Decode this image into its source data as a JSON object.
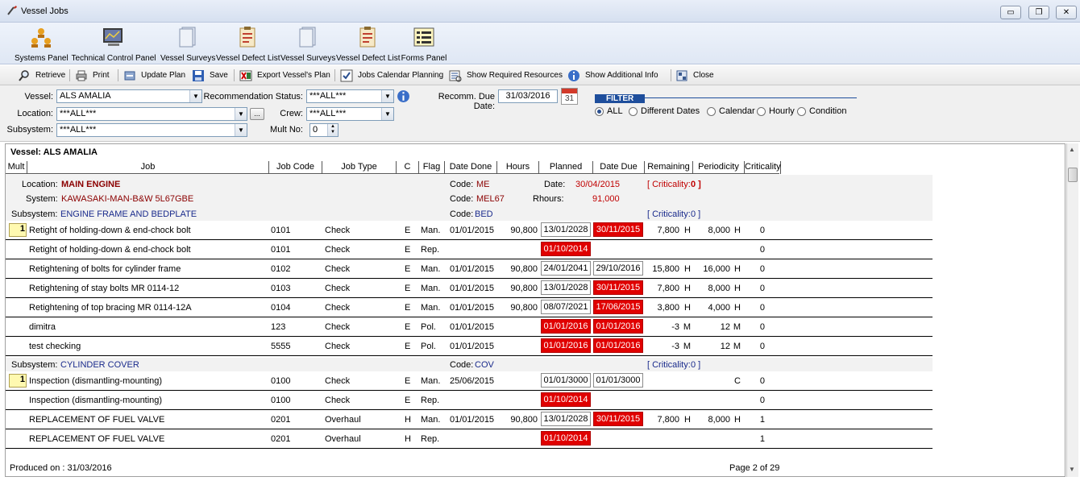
{
  "window": {
    "title": "Vessel Jobs",
    "minimize": "▭",
    "restore": "❐",
    "close": "✕"
  },
  "panels": [
    {
      "label": "Systems Panel",
      "icon": "systems-panel-icon"
    },
    {
      "label": "Technical Control Panel",
      "icon": "technical-control-panel-icon"
    },
    {
      "label": "Vessel Surveys",
      "icon": "vessel-surveys-icon"
    },
    {
      "label": "Vessel Defect List",
      "icon": "vessel-defect-list-icon"
    },
    {
      "label": "Vessel Surveys",
      "icon": "vessel-surveys-icon"
    },
    {
      "label": "Vessel Defect List",
      "icon": "vessel-defect-list-icon"
    },
    {
      "label": "Forms Panel",
      "icon": "forms-panel-icon"
    }
  ],
  "toolbar": {
    "retrieve": "Retrieve",
    "print": "Print",
    "update_plan": "Update Plan",
    "save": "Save",
    "export": "Export Vessel's Plan",
    "calendar": "Jobs Calendar Planning",
    "resources": "Show Required Resources",
    "info": "Show Additional Info",
    "close": "Close"
  },
  "filters": {
    "vessel_label": "Vessel:",
    "vessel_value": "ALS AMALIA",
    "location_label": "Location:",
    "location_value": "***ALL***",
    "subsystem_label": "Subsystem:",
    "subsystem_value": "***ALL***",
    "rec_status_label": "Recommendation Status:",
    "rec_status_value": "***ALL***",
    "crew_label": "Crew:",
    "crew_value": "***ALL***",
    "mult_label": "Mult No:",
    "mult_value": "0",
    "due_date_label": "Recomm. Due Date:",
    "due_date_value": "31/03/2016",
    "calendar_day": "31",
    "ellipsis": "...",
    "filter_title": "FILTER",
    "radios": [
      "ALL",
      "Different Dates",
      "Calendar",
      "Hourly",
      "Condition"
    ],
    "radio_selected": "ALL"
  },
  "report": {
    "vessel_header": "Vessel:  ALS AMALIA",
    "columns": [
      "Mult",
      "Job",
      "Job Code",
      "Job Type",
      "C",
      "Flag",
      "Date Done",
      "Hours",
      "Planned",
      "Date Due",
      "Remaining",
      "Periodicity",
      "Criticality"
    ],
    "location": {
      "location_label": "Location:",
      "location_value": "MAIN ENGINE",
      "system_label": "System:",
      "system_value": "KAWASAKI-MAN-B&W 5L67GBE",
      "code_label": "Code:",
      "code_value": "ME",
      "date_label": "Date:",
      "date_value": "30/04/2015",
      "criticality_label": "[ Criticality:",
      "criticality_value": "0 ]",
      "code2_label": "Code:",
      "code2_value": "MEL67",
      "rhours_label": "Rhours:",
      "rhours_value": "91,000"
    },
    "subsystems": [
      {
        "label": "Subsystem:",
        "name": "ENGINE FRAME AND BEDPLATE",
        "code_label": "Code:",
        "code": "BED",
        "criticality_label": "[ Criticality:",
        "criticality": "0 ]",
        "rows": [
          {
            "mult": "1",
            "job": "Retight of holding-down & end-chock bolt",
            "code": "0101",
            "type": "Check",
            "c": "E",
            "flag": "Man.",
            "done": "01/01/2015",
            "hours": "90,800",
            "planned": "13/01/2028",
            "planned_red": false,
            "due": "30/11/2015",
            "due_red": true,
            "remaining": "7,800",
            "rem_unit": "H",
            "period": "8,000",
            "per_unit": "H",
            "crit": "0"
          },
          {
            "mult": "",
            "job": "Retight of holding-down & end-chock bolt",
            "code": "0101",
            "type": "Check",
            "c": "E",
            "flag": "Rep.",
            "done": "",
            "hours": "",
            "planned": "01/10/2014",
            "planned_red": true,
            "due": "",
            "due_red": false,
            "remaining": "",
            "rem_unit": "",
            "period": "",
            "per_unit": "",
            "crit": "0"
          },
          {
            "mult": "",
            "job": "Retightening of bolts for cylinder frame",
            "code": "0102",
            "type": "Check",
            "c": "E",
            "flag": "Man.",
            "done": "01/01/2015",
            "hours": "90,800",
            "planned": "24/01/2041",
            "planned_red": false,
            "due": "29/10/2016",
            "due_red": false,
            "remaining": "15,800",
            "rem_unit": "H",
            "period": "16,000",
            "per_unit": "H",
            "crit": "0"
          },
          {
            "mult": "",
            "job": "Retightening of stay bolts MR 0114-12",
            "code": "0103",
            "type": "Check",
            "c": "E",
            "flag": "Man.",
            "done": "01/01/2015",
            "hours": "90,800",
            "planned": "13/01/2028",
            "planned_red": false,
            "due": "30/11/2015",
            "due_red": true,
            "remaining": "7,800",
            "rem_unit": "H",
            "period": "8,000",
            "per_unit": "H",
            "crit": "0"
          },
          {
            "mult": "",
            "job": "Retightening of top bracing MR 0114-12A",
            "code": "0104",
            "type": "Check",
            "c": "E",
            "flag": "Man.",
            "done": "01/01/2015",
            "hours": "90,800",
            "planned": "08/07/2021",
            "planned_red": false,
            "due": "17/06/2015",
            "due_red": true,
            "remaining": "3,800",
            "rem_unit": "H",
            "period": "4,000",
            "per_unit": "H",
            "crit": "0"
          },
          {
            "mult": "",
            "job": "dimitra",
            "code": "123",
            "type": "Check",
            "c": "E",
            "flag": "Pol.",
            "done": "01/01/2015",
            "hours": "",
            "planned": "01/01/2016",
            "planned_red": true,
            "due": "01/01/2016",
            "due_red": true,
            "remaining": "-3",
            "rem_unit": "M",
            "period": "12",
            "per_unit": "M",
            "crit": "0"
          },
          {
            "mult": "",
            "job": "test checking",
            "code": "5555",
            "type": "Check",
            "c": "E",
            "flag": "Pol.",
            "done": "01/01/2015",
            "hours": "",
            "planned": "01/01/2016",
            "planned_red": true,
            "due": "01/01/2016",
            "due_red": true,
            "remaining": "-3",
            "rem_unit": "M",
            "period": "12",
            "per_unit": "M",
            "crit": "0"
          }
        ]
      },
      {
        "label": "Subsystem:",
        "name": "CYLINDER COVER",
        "code_label": "Code:",
        "code": "COV",
        "criticality_label": "[ Criticality:",
        "criticality": "0 ]",
        "rows": [
          {
            "mult": "1",
            "job": "Inspection  (dismantling-mounting)",
            "code": "0100",
            "type": "Check",
            "c": "E",
            "flag": "Man.",
            "done": "25/06/2015",
            "hours": "",
            "planned": "01/01/3000",
            "planned_red": false,
            "due": "01/01/3000",
            "due_red": false,
            "remaining": "",
            "rem_unit": "",
            "period": "",
            "per_unit": "C",
            "crit": "0"
          },
          {
            "mult": "",
            "job": "Inspection  (dismantling-mounting)",
            "code": "0100",
            "type": "Check",
            "c": "E",
            "flag": "Rep.",
            "done": "",
            "hours": "",
            "planned": "01/10/2014",
            "planned_red": true,
            "due": "",
            "due_red": false,
            "remaining": "",
            "rem_unit": "",
            "period": "",
            "per_unit": "",
            "crit": "0"
          },
          {
            "mult": "",
            "job": "REPLACEMENT OF FUEL VALVE",
            "code": "0201",
            "type": "Overhaul",
            "c": "H",
            "flag": "Man.",
            "done": "01/01/2015",
            "hours": "90,800",
            "planned": "13/01/2028",
            "planned_red": false,
            "due": "30/11/2015",
            "due_red": true,
            "remaining": "7,800",
            "rem_unit": "H",
            "period": "8,000",
            "per_unit": "H",
            "crit": "1"
          },
          {
            "mult": "",
            "job": "REPLACEMENT OF FUEL VALVE",
            "code": "0201",
            "type": "Overhaul",
            "c": "H",
            "flag": "Rep.",
            "done": "",
            "hours": "",
            "planned": "01/10/2014",
            "planned_red": true,
            "due": "",
            "due_red": false,
            "remaining": "",
            "rem_unit": "",
            "period": "",
            "per_unit": "",
            "crit": "1"
          }
        ]
      }
    ],
    "produced_on": "Produced on : 31/03/2016",
    "page": "Page 2 of 29"
  },
  "colors": {
    "accent_blue": "#1e4e9c",
    "due_red": "#e00000",
    "dark_red": "#8b0000"
  }
}
